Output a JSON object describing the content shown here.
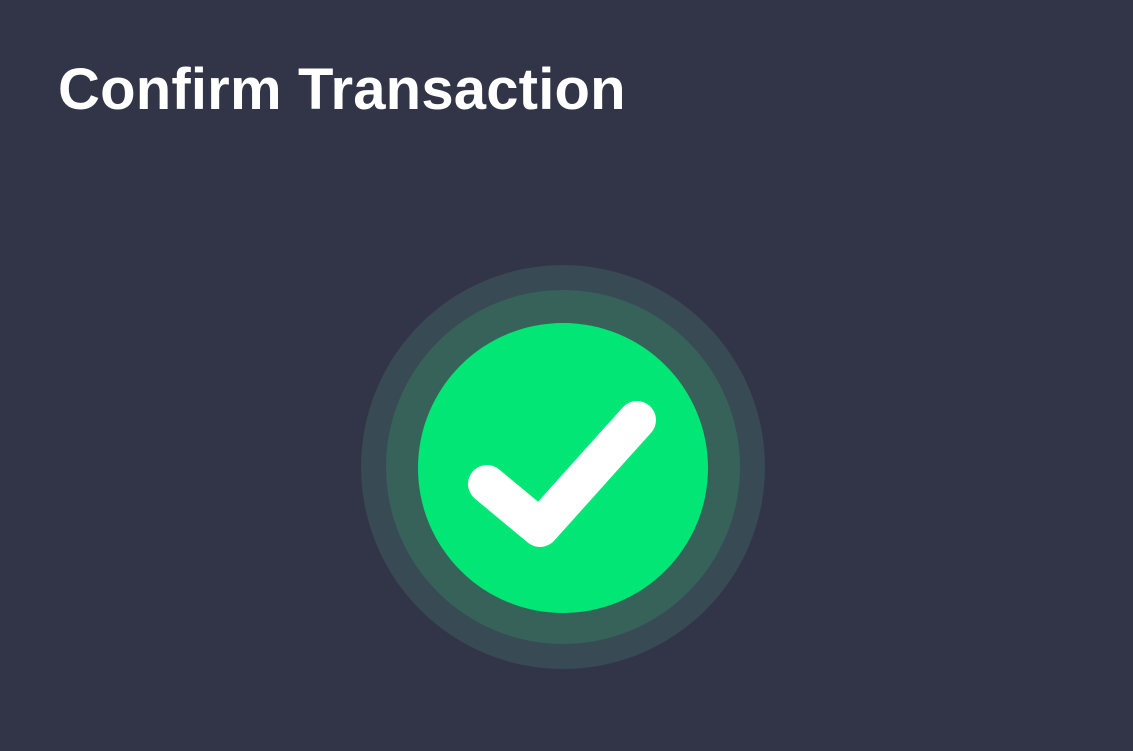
{
  "header": {
    "title": "Confirm Transaction"
  },
  "status": {
    "state": "success",
    "icon": "checkmark-icon",
    "colors": {
      "background": "#323548",
      "title": "#FFFFFF",
      "success_fill": "#02E676",
      "halo_inner": "#37625A",
      "halo_outer": "#384A53",
      "check_mark": "#FFFFFF"
    }
  }
}
